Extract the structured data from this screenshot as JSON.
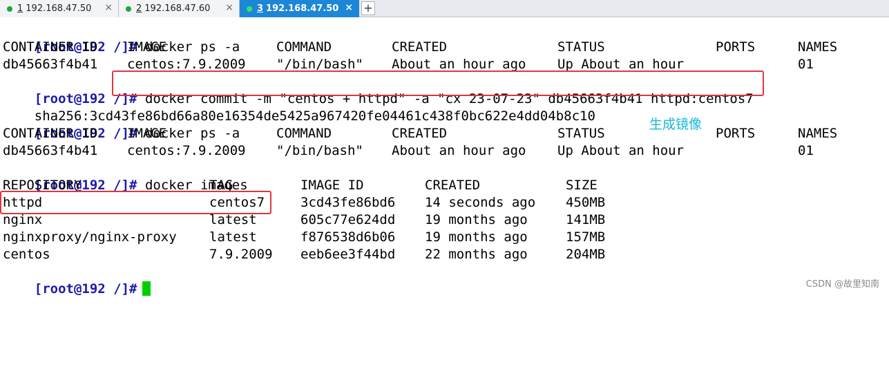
{
  "tabs": [
    {
      "num": "1",
      "host": "192.168.47.50",
      "active": false,
      "close": "×"
    },
    {
      "num": "2",
      "host": "192.168.47.60",
      "active": false,
      "close": "×"
    },
    {
      "num": "3",
      "host": "192.168.47.50",
      "active": true,
      "close": "×"
    }
  ],
  "tab_add": "+",
  "prompt": "[root@192 /]#",
  "commands": {
    "ps1": "docker ps -a",
    "commit": "docker commit -m \"centos + httpd\" -a \"cx 23-07-23\" db45663f4b41 httpd:centos7",
    "ps2": "docker ps -a",
    "images": "docker images"
  },
  "sha": "sha256:3cd43fe86bd66a80e16354de5425a967420fe04461c438f0bc622e4dd04b8c10",
  "ps_headers": [
    "CONTAINER ID",
    "IMAGE",
    "COMMAND",
    "CREATED",
    "STATUS",
    "PORTS",
    "NAMES"
  ],
  "ps_row": [
    "db45663f4b41",
    "centos:7.9.2009",
    "\"/bin/bash\"",
    "About an hour ago",
    "Up About an hour",
    "",
    "01"
  ],
  "img_headers": [
    "REPOSITORY",
    "TAG",
    "IMAGE ID",
    "CREATED",
    "SIZE"
  ],
  "img_rows": [
    [
      "httpd",
      "centos7",
      "3cd43fe86bd6",
      "14 seconds ago",
      "450MB"
    ],
    [
      "nginx",
      "latest",
      "605c77e624dd",
      "19 months ago",
      "141MB"
    ],
    [
      "nginxproxy/nginx-proxy",
      "latest",
      "f876538d6b06",
      "19 months ago",
      "157MB"
    ],
    [
      "centos",
      "7.9.2009",
      "eeb6ee3f44bd",
      "22 months ago",
      "204MB"
    ]
  ],
  "annotation": "生成镜像",
  "watermark": "CSDN @故里知南",
  "colors": {
    "prompt": "#1a1aa8",
    "annotation": "#17b7d8",
    "highlight": "#e0353d",
    "cursor": "#00d000",
    "active_tab": "#1d86d6"
  }
}
